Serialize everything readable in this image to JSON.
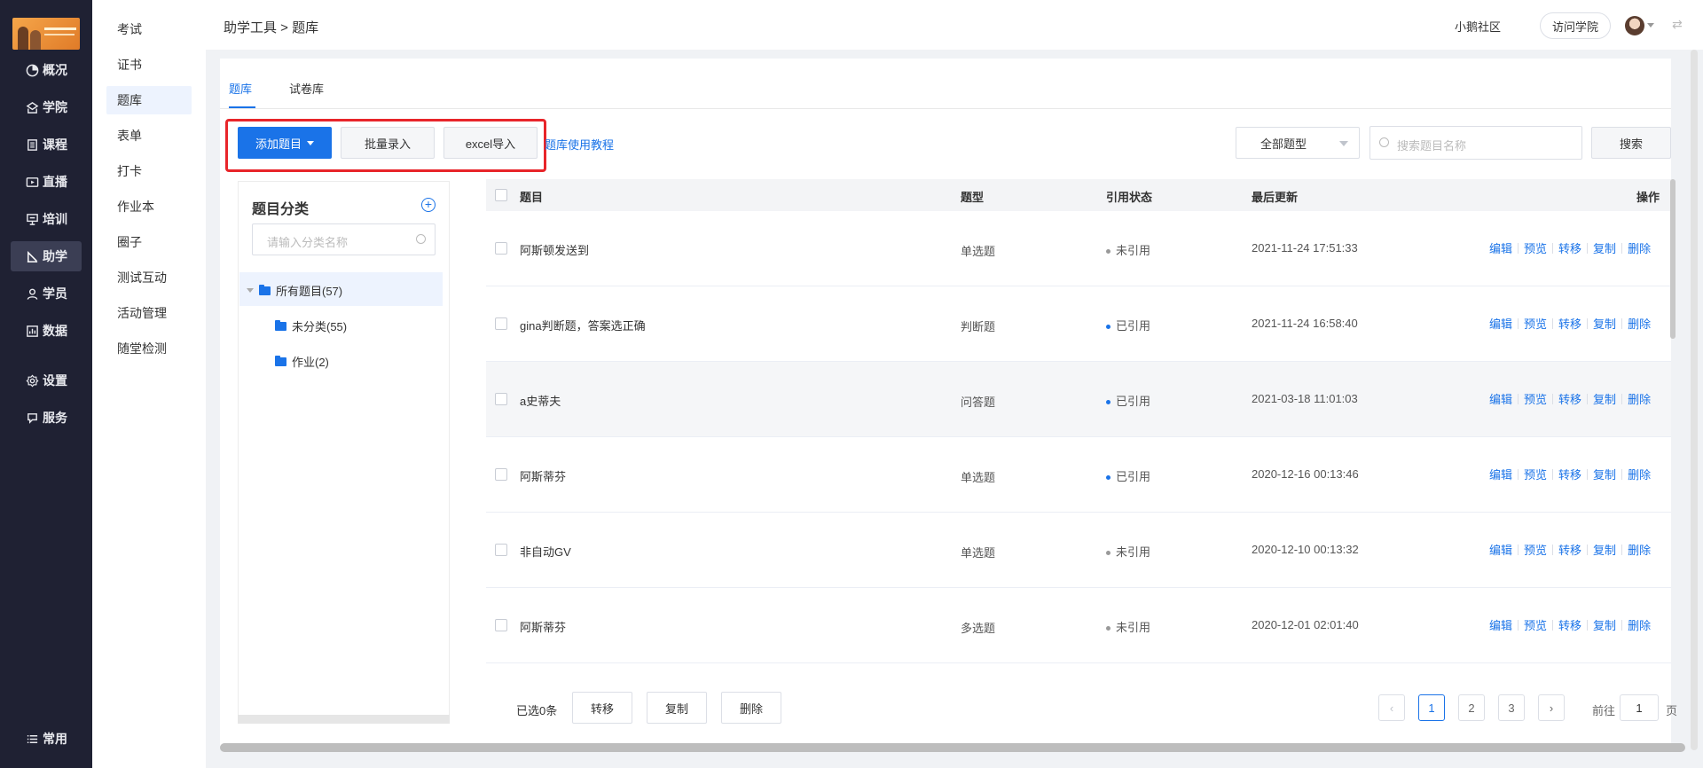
{
  "nav_primary": [
    {
      "label": "概况",
      "icon": "pie-chart-icon"
    },
    {
      "label": "学院",
      "icon": "school-icon"
    },
    {
      "label": "课程",
      "icon": "book-icon"
    },
    {
      "label": "直播",
      "icon": "live-icon"
    },
    {
      "label": "培训",
      "icon": "training-icon"
    },
    {
      "label": "助学",
      "icon": "study-help-icon",
      "active": true
    },
    {
      "label": "学员",
      "icon": "user-icon"
    },
    {
      "label": "数据",
      "icon": "data-icon"
    },
    {
      "label": "设置",
      "icon": "gear-icon"
    },
    {
      "label": "服务",
      "icon": "service-icon"
    }
  ],
  "nav_primary_bottom": {
    "label": "常用",
    "icon": "list-icon"
  },
  "nav_secondary": [
    {
      "label": "考试"
    },
    {
      "label": "证书"
    },
    {
      "label": "题库",
      "active": true
    },
    {
      "label": "表单"
    },
    {
      "label": "打卡"
    },
    {
      "label": "作业本"
    },
    {
      "label": "圈子"
    },
    {
      "label": "测试互动"
    },
    {
      "label": "活动管理"
    },
    {
      "label": "随堂检测"
    }
  ],
  "header": {
    "breadcrumb": "助学工具 > 题库",
    "community": "小鹅社区",
    "visit_academy": "访问学院"
  },
  "tabs": [
    {
      "label": "题库",
      "active": true
    },
    {
      "label": "试卷库"
    }
  ],
  "toolbar": {
    "add_question": "添加题目",
    "batch_entry": "批量录入",
    "excel_import": "excel导入",
    "tutorial_link": "题库使用教程",
    "type_filter": "全部题型",
    "search_placeholder": "搜索题目名称",
    "search_button": "搜索"
  },
  "category": {
    "title": "题目分类",
    "search_placeholder": "请输入分类名称",
    "root": "所有题目(57)",
    "children": [
      "未分类(55)",
      "作业(2)"
    ]
  },
  "table": {
    "headers": {
      "title": "题目",
      "type": "题型",
      "status": "引用状态",
      "updated": "最后更新",
      "ops": "操作"
    },
    "rows": [
      {
        "title": "阿斯顿发送到",
        "type": "单选题",
        "status": "未引用",
        "status_color": "#999999",
        "updated": "2021-11-24 17:51:33"
      },
      {
        "title": "gina判断题，答案选正确",
        "type": "判断题",
        "status": "已引用",
        "status_color": "#1a73e8",
        "updated": "2021-11-24 16:58:40"
      },
      {
        "title": "a史蒂夫",
        "type": "问答题",
        "status": "已引用",
        "status_color": "#1a73e8",
        "updated": "2021-03-18 11:01:03",
        "highlight": true
      },
      {
        "title": "阿斯蒂芬",
        "type": "单选题",
        "status": "已引用",
        "status_color": "#1a73e8",
        "updated": "2020-12-16 00:13:46"
      },
      {
        "title": "非自动GV",
        "type": "单选题",
        "status": "未引用",
        "status_color": "#999999",
        "updated": "2020-12-10 00:13:32"
      },
      {
        "title": "阿斯蒂芬",
        "type": "多选题",
        "status": "未引用",
        "status_color": "#999999",
        "updated": "2020-12-01 02:01:40"
      }
    ],
    "row_ops": [
      "编辑",
      "预览",
      "转移",
      "复制",
      "删除"
    ]
  },
  "footer": {
    "selected": "已选0条",
    "move": "转移",
    "copy": "复制",
    "delete": "删除",
    "pages": [
      "1",
      "2",
      "3"
    ],
    "current_page": "1",
    "goto_label": "前往",
    "goto_value": "1",
    "page_suffix": "页"
  },
  "colors": {
    "accent": "#1a73e8",
    "sidebar": "#1f2133",
    "highlight_box": "#e8252a"
  }
}
